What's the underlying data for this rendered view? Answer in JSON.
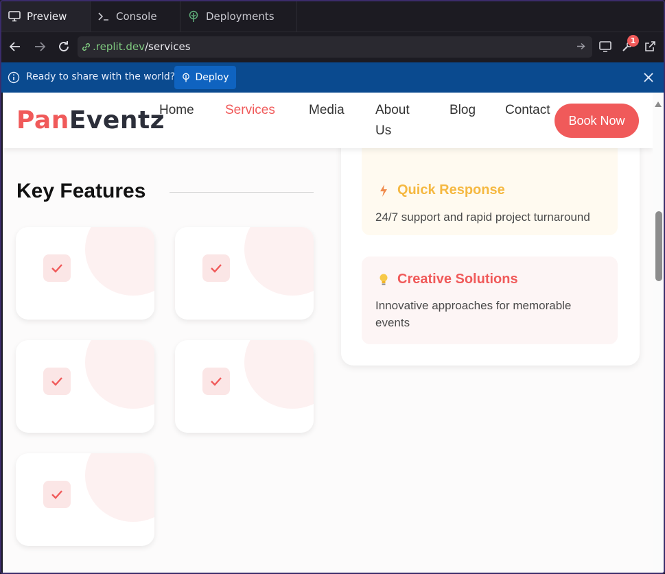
{
  "tabs": [
    {
      "label": "Preview",
      "icon": "monitor-icon"
    },
    {
      "label": "Console",
      "icon": "terminal-icon"
    },
    {
      "label": "Deployments",
      "icon": "deploy-tree-icon"
    }
  ],
  "url": {
    "host": ".replit.dev",
    "path": "/services"
  },
  "toolbar": {
    "notification_count": "1"
  },
  "banner": {
    "text": "Ready to share with the world?",
    "deploy_label": "Deploy"
  },
  "site": {
    "logo_accent": "Pan",
    "logo_rest": "Eventz",
    "nav": [
      "Home",
      "Services",
      "Media",
      "About Us",
      "Blog",
      "Contact"
    ],
    "active_nav": "Services",
    "book_label": "Book Now"
  },
  "key_features": {
    "title": "Key Features"
  },
  "features_panel": [
    {
      "title": "Quick Response",
      "description": "24/7 support and rapid project turnaround",
      "icon": "lightning-icon",
      "color": "#f5b841",
      "bg": "#fffaf0"
    },
    {
      "title": "Creative Solutions",
      "description": "Innovative approaches for memorable events",
      "icon": "lightbulb-icon",
      "color": "#f05a5a",
      "bg": "#fdf5f5"
    }
  ],
  "colors": {
    "brand": "#f05a5a",
    "banner": "#0a4a8f",
    "deploy_button": "#0f63c0"
  }
}
